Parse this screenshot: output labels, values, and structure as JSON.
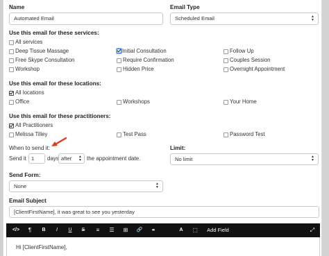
{
  "form": {
    "name_label": "Name",
    "name_value": "Automated Email",
    "email_type_label": "Email Type",
    "email_type_value": "Scheduled Email",
    "services_label": "Use this email for these services:",
    "services": [
      {
        "label": "All services",
        "checked": false
      },
      {
        "label": "Deep Tissue Massage",
        "checked": false
      },
      {
        "label": "Initial Consultation",
        "checked": true
      },
      {
        "label": "Follow Up",
        "checked": false
      },
      {
        "label": "Free Skype Consultation",
        "checked": false
      },
      {
        "label": "Require Confirmation",
        "checked": false
      },
      {
        "label": "Couples Session",
        "checked": false
      },
      {
        "label": "Workshop",
        "checked": false
      },
      {
        "label": "Hidden Price",
        "checked": false
      },
      {
        "label": "Overnight Appointment",
        "checked": false
      }
    ],
    "locations_label": "Use this email for these locations:",
    "locations": [
      {
        "label": "All locations",
        "checked": true
      },
      {
        "label": "Office",
        "checked": false
      },
      {
        "label": "Workshops",
        "checked": false
      },
      {
        "label": "Your Home",
        "checked": false
      }
    ],
    "practitioners_label": "Use this email for these practitioners:",
    "practitioners": [
      {
        "label": "All Practitioners",
        "checked": true
      },
      {
        "label": "Melissa Tilley",
        "checked": false
      },
      {
        "label": "Test Pass",
        "checked": false
      },
      {
        "label": "Password Test",
        "checked": false
      }
    ],
    "when_label": "When to send it:",
    "send_it_text": "Send it",
    "days_value": "1",
    "days_text": "days",
    "timing_value": "after",
    "appointment_text": "the appointment date.",
    "limit_label": "Limit:",
    "limit_value": "No limit",
    "send_form_label": "Send Form:",
    "send_form_value": "None",
    "subject_label": "Email Subject",
    "subject_value": "[ClientFirstName], it was great to see you yesterday",
    "body_first_line": "Hi [ClientFirstName],"
  },
  "toolbar": {
    "items": [
      "</>",
      "¶",
      "B",
      "I",
      "U",
      "S",
      "≡",
      "☰",
      "⊞",
      "🔗",
      "⚭",
      "A",
      "⬚"
    ],
    "add_field_label": "Add Field",
    "expand": "⤢"
  },
  "colors": {
    "toolbar_bg": "#111111",
    "annotation_arrow": "#e03a1e",
    "focus_blue": "#3a78d0"
  }
}
